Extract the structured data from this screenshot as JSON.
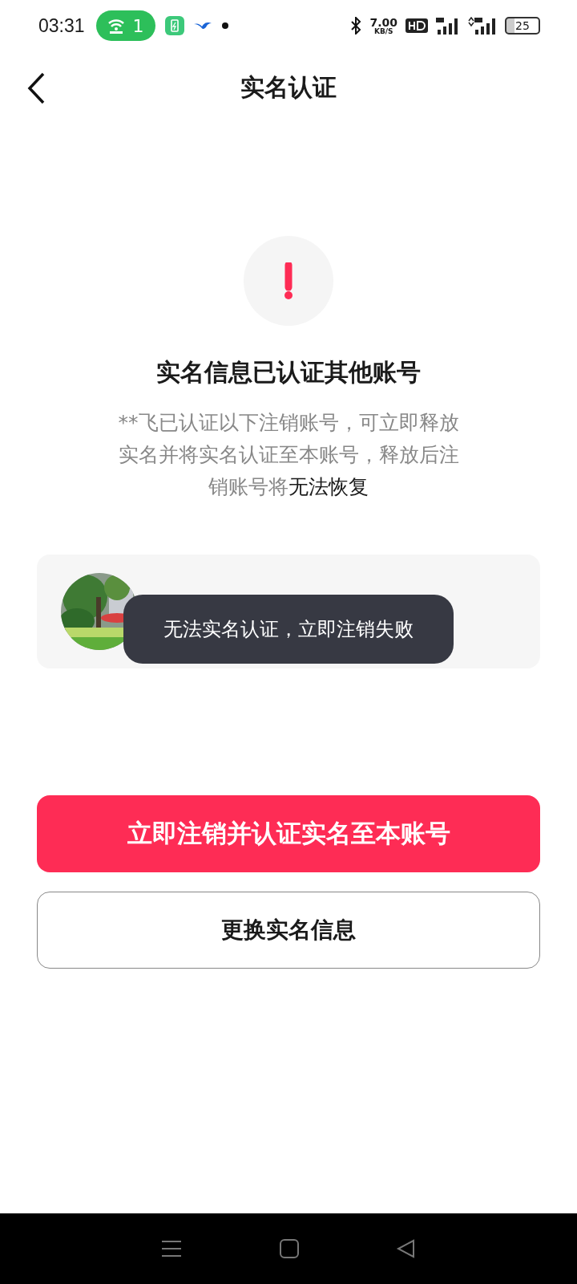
{
  "status_bar": {
    "time": "03:31",
    "hotspot_count": "1",
    "net_speed": "7.00",
    "net_unit": "KB/S",
    "battery": "25"
  },
  "header": {
    "title": "实名认证"
  },
  "notice": {
    "title": "实名信息已认证其他账号",
    "message": "**飞已认证以下注销账号，可立即释放实名并将实名认证至本账号，释放后注销账号将",
    "message_emphasis": "无法恢复"
  },
  "toast": "无法实名认证，立即注销失败",
  "buttons": [
    {
      "label": "立即注销并认证实名至本账号",
      "kind": "primary"
    },
    {
      "label": "更换实名信息",
      "kind": "outline"
    }
  ]
}
